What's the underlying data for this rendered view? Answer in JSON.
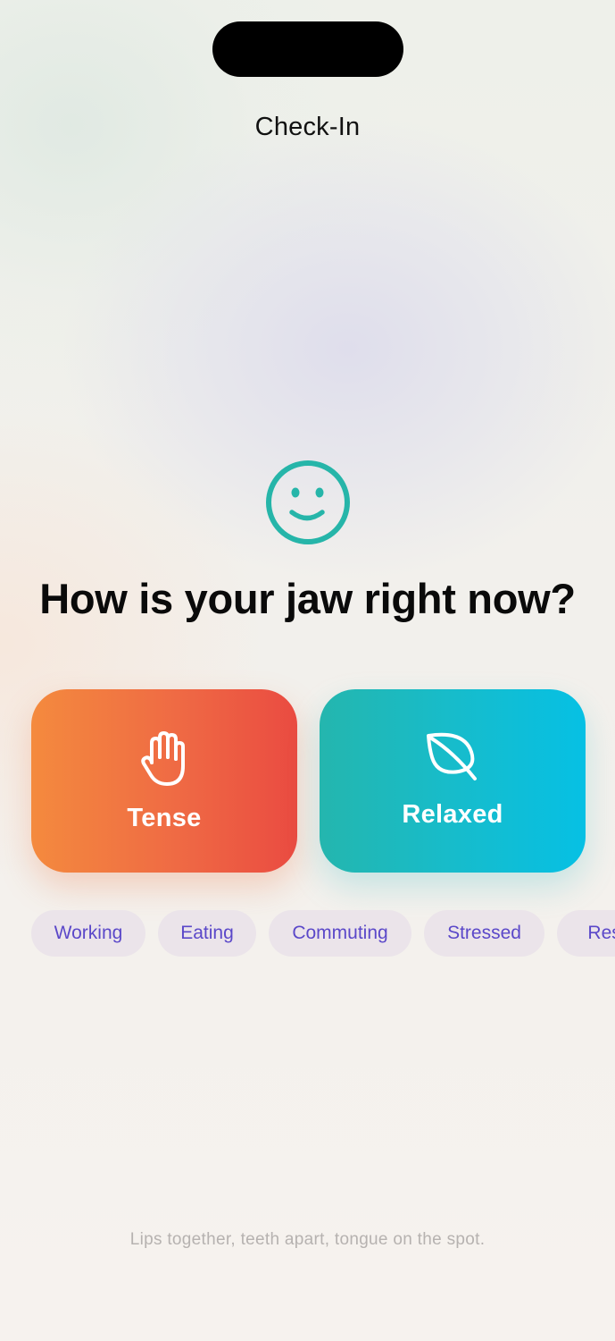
{
  "header": {
    "title": "Check-In"
  },
  "prompt": {
    "icon": "smiley-face-icon",
    "question": "How is your jaw right now?"
  },
  "choices": [
    {
      "label": "Tense",
      "icon": "raised-hand-icon",
      "gradient": [
        "#f48a3e",
        "#ea4b41"
      ]
    },
    {
      "label": "Relaxed",
      "icon": "leaf-icon",
      "gradient": [
        "#24b6ae",
        "#06c0e4"
      ]
    }
  ],
  "context_tags": [
    {
      "label": "Working"
    },
    {
      "label": "Eating"
    },
    {
      "label": "Commuting"
    },
    {
      "label": "Stressed"
    },
    {
      "label": "Rest"
    }
  ],
  "footer": {
    "hint": "Lips together, teeth apart, tongue on the spot."
  },
  "colors": {
    "accent_teal": "#26b5a9",
    "tag_text": "#5b48c9",
    "tag_bg": "#ebe4ea"
  }
}
